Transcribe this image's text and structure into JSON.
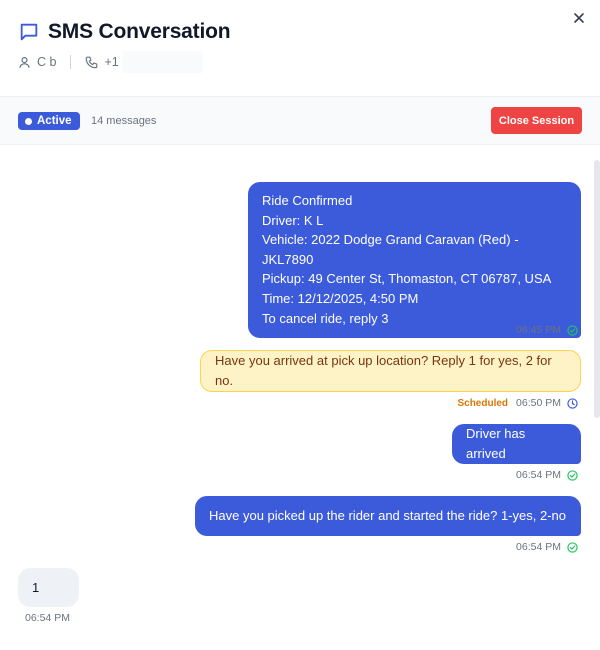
{
  "header": {
    "title": "SMS Conversation",
    "contact_name": "C b",
    "contact_phone": "+1"
  },
  "session": {
    "status": "Active",
    "message_count": "14 messages",
    "close_label": "Close Session"
  },
  "messages": [
    {
      "direction": "outgoing",
      "lines": [
        "Ride Confirmed",
        "Driver: K L",
        "Vehicle: 2022 Dodge Grand Caravan (Red) - JKL7890",
        "Pickup: 49 Center St, Thomaston, CT 06787, USA",
        "Time: 12/12/2025, 4:50 PM",
        "To cancel ride, reply 3"
      ],
      "time": "06:45 PM",
      "status_icon": "check-circle-icon"
    },
    {
      "direction": "outgoing-scheduled",
      "text": "Have you arrived at pick up location? Reply 1 for yes, 2 for no.",
      "status_label": "Scheduled",
      "time": "06:50 PM",
      "status_icon": "clock-icon"
    },
    {
      "direction": "outgoing",
      "text": "Driver has arrived",
      "time": "06:54 PM",
      "status_icon": "check-circle-icon"
    },
    {
      "direction": "outgoing",
      "text": "Have you picked up the rider and started the ride? 1-yes, 2-no",
      "time": "06:54 PM",
      "status_icon": "check-circle-icon"
    },
    {
      "direction": "incoming",
      "text": "1",
      "time": "06:54 PM"
    }
  ],
  "colors": {
    "primary": "#3b5bdb",
    "danger": "#ef4444",
    "scheduled_bg": "#fef3c7",
    "scheduled_border": "#fcd34d",
    "delivered": "#22c55e",
    "clock": "#3b5bdb"
  }
}
